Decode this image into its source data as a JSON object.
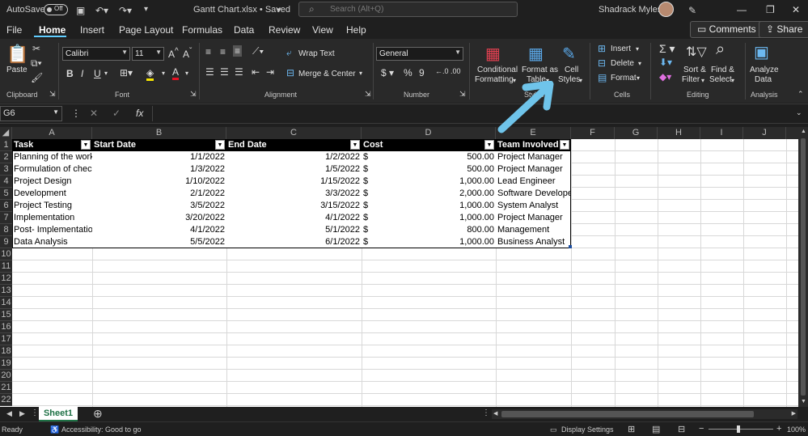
{
  "titlebar": {
    "autosave_label": "AutoSave",
    "autosave_state": "Off",
    "file_title": "Gantt Chart.xlsx • Saved",
    "search_placeholder": "Search (Alt+Q)",
    "user_name": "Shadrack Myles"
  },
  "tabs": [
    "File",
    "Home",
    "Insert",
    "Page Layout",
    "Formulas",
    "Data",
    "Review",
    "View",
    "Help"
  ],
  "active_tab": "Home",
  "comments_label": "Comments",
  "share_label": "Share",
  "ribbon": {
    "clipboard": {
      "paste": "Paste",
      "group": "Clipboard"
    },
    "font": {
      "name": "Calibri",
      "size": "11",
      "group": "Font"
    },
    "alignment": {
      "wrap": "Wrap Text",
      "merge": "Merge & Center",
      "group": "Alignment"
    },
    "number": {
      "format": "General",
      "group": "Number"
    },
    "styles": {
      "conditional_1": "Conditional",
      "conditional_2": "Formatting",
      "format_as_1": "Format as",
      "format_as_2": "Table",
      "cell_styles_1": "Cell",
      "cell_styles_2": "Styles",
      "group": "Styles"
    },
    "cells": {
      "insert": "Insert",
      "delete": "Delete",
      "format": "Format",
      "group": "Cells"
    },
    "editing": {
      "sort_1": "Sort &",
      "sort_2": "Filter",
      "find_1": "Find &",
      "find_2": "Select",
      "group": "Editing"
    },
    "analysis": {
      "analyze_1": "Analyze",
      "analyze_2": "Data",
      "group": "Analysis"
    }
  },
  "formula_bar": {
    "name_box": "G6",
    "fx": "fx",
    "value": ""
  },
  "columns": [
    "A",
    "B",
    "C",
    "D",
    "E",
    "F",
    "G",
    "H",
    "I",
    "J"
  ],
  "row_numbers": [
    "1",
    "2",
    "3",
    "4",
    "5",
    "6",
    "7",
    "8",
    "9",
    "10",
    "11",
    "12",
    "13",
    "14",
    "15",
    "16",
    "17",
    "18",
    "19",
    "20",
    "21",
    "22"
  ],
  "table": {
    "headers": [
      "Task",
      "Start Date",
      "End Date",
      "Cost",
      "Team Involved"
    ],
    "rows": [
      {
        "task": "Planning of the work",
        "start": "1/1/2022",
        "end": "1/2/2022",
        "cur": "$",
        "cost": "500.00",
        "team": "Project Manager"
      },
      {
        "task": "Formulation of check",
        "start": "1/3/2022",
        "end": "1/5/2022",
        "cur": "$",
        "cost": "500.00",
        "team": "Project Manager"
      },
      {
        "task": "Project Design",
        "start": "1/10/2022",
        "end": "1/15/2022",
        "cur": "$",
        "cost": "1,000.00",
        "team": "Lead Engineer"
      },
      {
        "task": "Development",
        "start": "2/1/2022",
        "end": "3/3/2022",
        "cur": "$",
        "cost": "2,000.00",
        "team": "Software Developer"
      },
      {
        "task": "Project Testing",
        "start": "3/5/2022",
        "end": "3/15/2022",
        "cur": "$",
        "cost": "1,000.00",
        "team": "System Analyst"
      },
      {
        "task": "Implementation",
        "start": "3/20/2022",
        "end": "4/1/2022",
        "cur": "$",
        "cost": "1,000.00",
        "team": "Project Manager"
      },
      {
        "task": "Post- Implementation",
        "start": "4/1/2022",
        "end": "5/1/2022",
        "cur": "$",
        "cost": "800.00",
        "team": "Management"
      },
      {
        "task": "Data Analysis",
        "start": "5/5/2022",
        "end": "6/1/2022",
        "cur": "$",
        "cost": "1,000.00",
        "team": "Business Analyst"
      }
    ]
  },
  "sheet_tab": "Sheet1",
  "status": {
    "ready": "Ready",
    "accessibility": "Accessibility: Good to go",
    "display_settings": "Display Settings",
    "zoom": "100%"
  },
  "colors": {
    "accent": "#60cdff",
    "table_header": "#000000",
    "sheet_tab": "#1e7145",
    "annotation_arrow": "#6fc4ea"
  }
}
